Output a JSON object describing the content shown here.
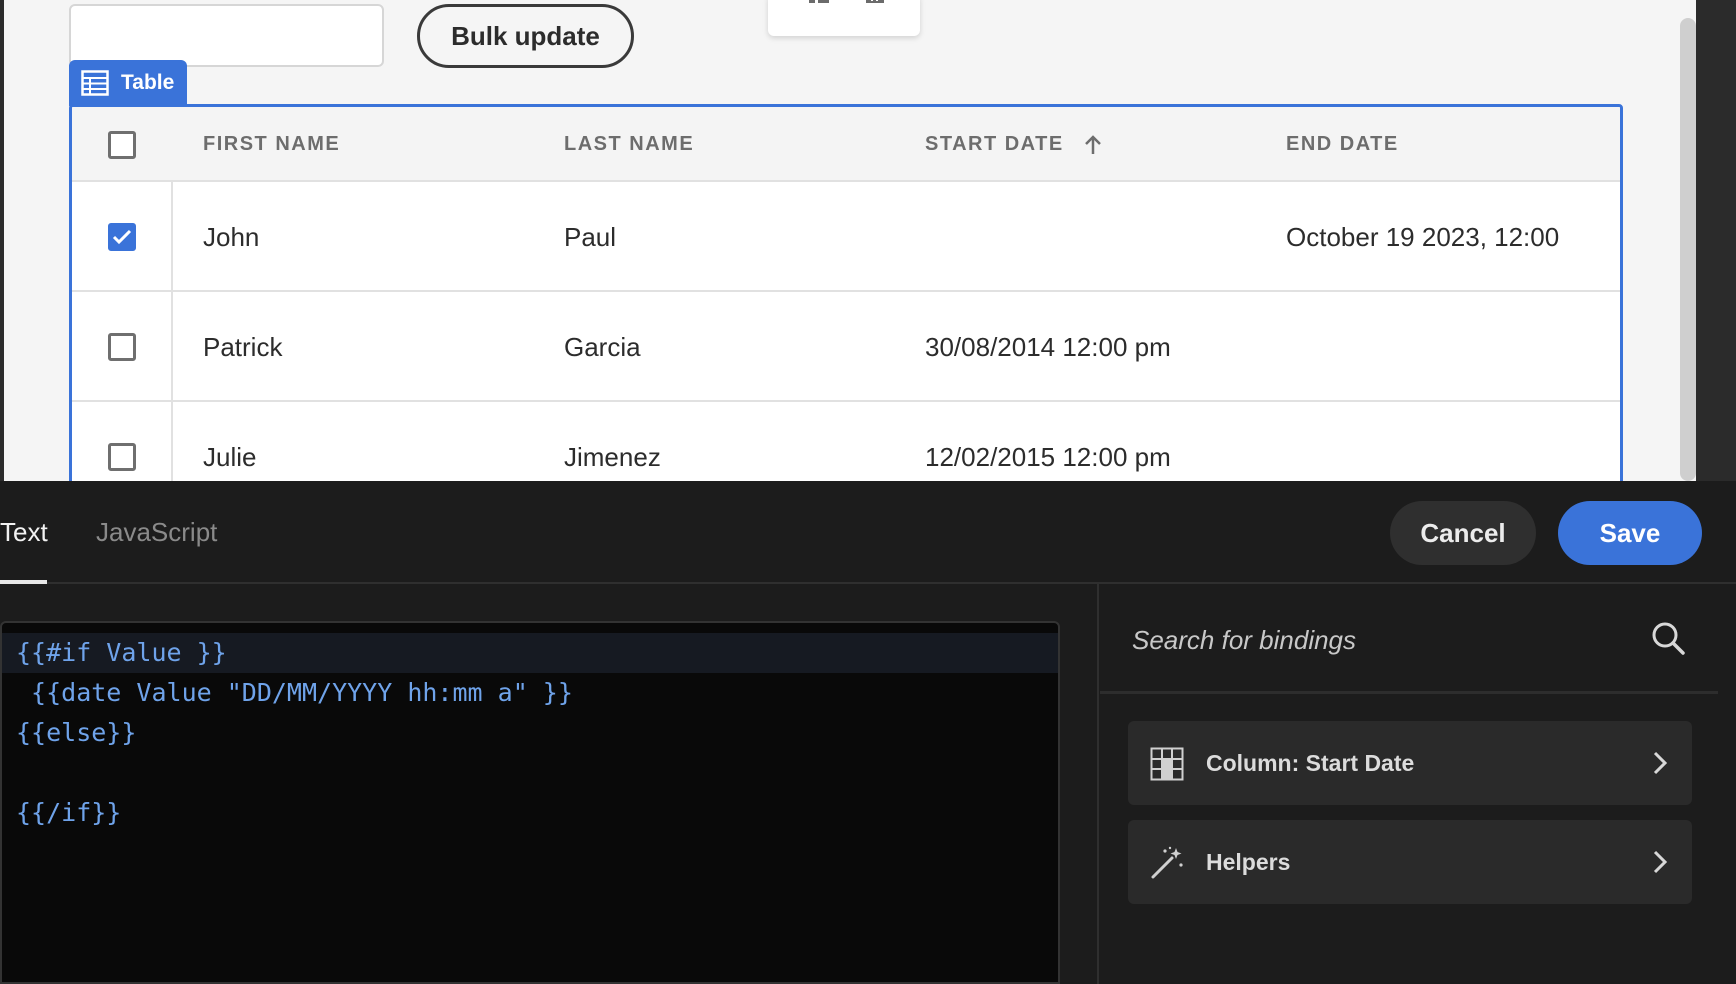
{
  "toolbar": {
    "bulk_update_label": "Bulk update",
    "text_input_value": ""
  },
  "table": {
    "tag_label": "Table",
    "columns": [
      "FIRST NAME",
      "LAST NAME",
      "START DATE",
      "END DATE"
    ],
    "sort_column": "START DATE",
    "sort_direction": "ascending",
    "rows": [
      {
        "first_name": "John",
        "last_name": "Paul",
        "start_date": "",
        "end_date": "October 19 2023, 12:00",
        "checked": true
      },
      {
        "first_name": "Patrick",
        "last_name": "Garcia",
        "start_date": "30/08/2014 12:00 pm",
        "end_date": "",
        "checked": false
      },
      {
        "first_name": "Julie",
        "last_name": "Jimenez",
        "start_date": "12/02/2015 12:00 pm",
        "end_date": "",
        "checked": false
      }
    ]
  },
  "editor": {
    "tabs": [
      "Text",
      "JavaScript"
    ],
    "active_tab": "Text",
    "cancel_label": "Cancel",
    "save_label": "Save",
    "code_lines": [
      "{{#if Value }}",
      " {{date Value \"DD/MM/YYYY hh:mm a\" }}",
      "{{else}}",
      "",
      "{{/if}}"
    ]
  },
  "bindings": {
    "search_placeholder": "Search for bindings",
    "items": [
      {
        "label": "Column: Start Date",
        "icon": "table-column-icon"
      },
      {
        "label": "Helpers",
        "icon": "magic-wand-icon"
      }
    ]
  },
  "colors": {
    "accent": "#3a73d9",
    "code_text": "#6fa3ea",
    "editor_bg": "#1c1c1c"
  }
}
